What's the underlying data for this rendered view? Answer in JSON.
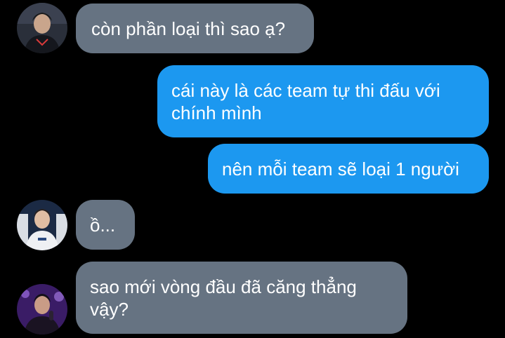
{
  "conversation": {
    "messages": [
      {
        "direction": "incoming",
        "avatar": "avatar-player-dark-jersey",
        "text": "còn phần loại thì sao ạ?"
      },
      {
        "direction": "outgoing",
        "text": "cái này là các team tự thi đấu với chính mình"
      },
      {
        "direction": "outgoing",
        "text": "nên mỗi team sẽ loại 1 người"
      },
      {
        "direction": "incoming",
        "avatar": "avatar-player-white-jersey",
        "text": "ồ..."
      },
      {
        "direction": "incoming",
        "avatar": "avatar-player-purple-stage",
        "text": "sao mới vòng đầu đã căng thẳng vậy?"
      }
    ]
  },
  "colors": {
    "background": "#000000",
    "incoming_bubble": "#667382",
    "outgoing_bubble": "#1c98f0",
    "text": "#ffffff"
  }
}
